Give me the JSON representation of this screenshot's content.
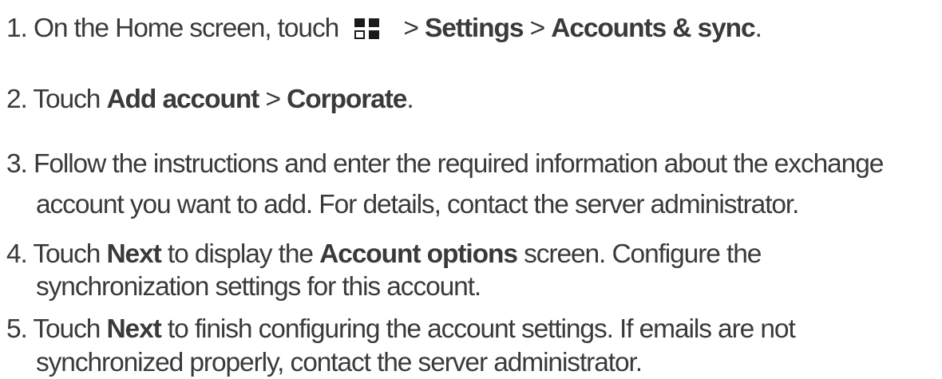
{
  "steps": [
    {
      "number": "1.",
      "t1": "On the Home screen, touch",
      "icon": "apps-grid-icon",
      "t2": " > ",
      "b1": "Settings",
      "t3": " > ",
      "b2": "Accounts & sync",
      "t4": "."
    },
    {
      "number": "2.",
      "t1": "Touch ",
      "b1": "Add account",
      "t2": " > ",
      "b2": "Corporate",
      "t3": "."
    },
    {
      "number": "3.",
      "line1": "Follow the instructions and enter the required information about the exchange",
      "line2": "account you want to add. For details, contact the server administrator."
    },
    {
      "number": "4.",
      "t1": "Touch ",
      "b1": "Next",
      "t2": " to display the ",
      "b2": "Account options",
      "t3": " screen. Configure the",
      "line2": "synchronization settings for this account."
    },
    {
      "number": "5.",
      "t1": "Touch ",
      "b1": "Next",
      "t2": " to finish configuring the account settings. If emails are not",
      "line2": "synchronized properly, contact the server administrator."
    }
  ]
}
